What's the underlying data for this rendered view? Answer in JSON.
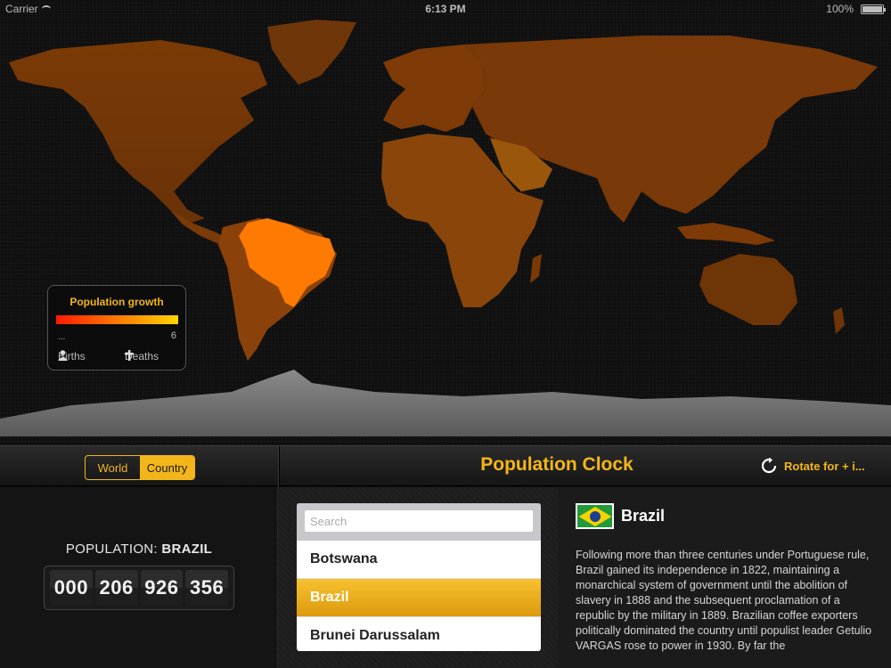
{
  "status_bar": {
    "carrier": "Carrier",
    "time": "6:13 PM",
    "battery": "100%"
  },
  "legend": {
    "title": "Population growth",
    "min": "...",
    "max": "6",
    "births": "Births",
    "deaths": "Deaths"
  },
  "toolbar": {
    "segments": [
      "World",
      "Country"
    ],
    "selected_segment": "Country",
    "title": "Population Clock",
    "rotate_label": "Rotate for + i..."
  },
  "population": {
    "label_prefix": "POPULATION:",
    "country": "BRAZIL",
    "counter": [
      "000",
      "206",
      "926",
      "356"
    ]
  },
  "search": {
    "placeholder": "Search",
    "value": ""
  },
  "country_list": [
    {
      "name": "Botswana",
      "selected": false
    },
    {
      "name": "Brazil",
      "selected": true
    },
    {
      "name": "Brunei Darussalam",
      "selected": false
    }
  ],
  "country_info": {
    "name": "Brazil",
    "description": "Following more than three centuries under Portuguese rule, Brazil gained its independence in 1822, maintaining a monarchical system of government until the abolition of slavery in 1888 and the subsequent proclamation of a republic by the military in 1889. Brazilian coffee exporters politically dominated the country until populist leader Getulio VARGAS rose to power in 1930. By far the"
  },
  "colors": {
    "accent": "#f3b61a",
    "map_land": "#7a3a06",
    "highlight": "#ff7a00"
  },
  "icons": [
    "wifi-icon",
    "battery-icon",
    "person-icon",
    "cross-icon",
    "rotate-icon",
    "brazil-flag-icon"
  ]
}
